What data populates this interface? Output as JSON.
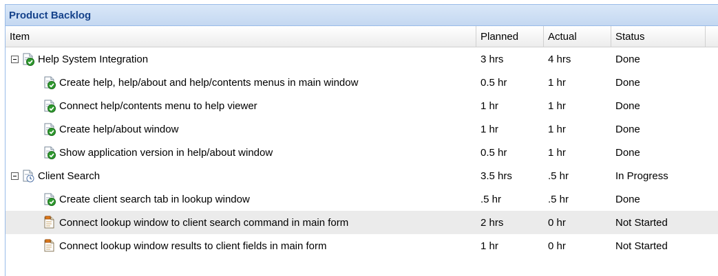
{
  "panel": {
    "title": "Product Backlog"
  },
  "columns": {
    "item": "Item",
    "planned": "Planned",
    "actual": "Actual",
    "status": "Status"
  },
  "rows": [
    {
      "item": "Help System Integration",
      "planned": "3 hrs",
      "actual": "4 hrs",
      "status": "Done",
      "level": 0,
      "icon": "task-done-icon",
      "expanded": true
    },
    {
      "item": "Create help, help/about and help/contents menus in main window",
      "planned": "0.5 hr",
      "actual": "1 hr",
      "status": "Done",
      "level": 1,
      "icon": "task-done-icon"
    },
    {
      "item": "Connect help/contents menu to help viewer",
      "planned": "1 hr",
      "actual": "1 hr",
      "status": "Done",
      "level": 1,
      "icon": "task-done-icon"
    },
    {
      "item": "Create help/about window",
      "planned": "1 hr",
      "actual": "1 hr",
      "status": "Done",
      "level": 1,
      "icon": "task-done-icon"
    },
    {
      "item": "Show application version in help/about window",
      "planned": "0.5 hr",
      "actual": "1 hr",
      "status": "Done",
      "level": 1,
      "icon": "task-done-icon"
    },
    {
      "item": "Client Search",
      "planned": "3.5 hrs",
      "actual": ".5 hr",
      "status": "In Progress",
      "level": 0,
      "icon": "task-in-progress-icon",
      "expanded": true
    },
    {
      "item": "Create client search tab in lookup window",
      "planned": ".5 hr",
      "actual": ".5 hr",
      "status": "Done",
      "level": 1,
      "icon": "task-done-icon"
    },
    {
      "item": "Connect lookup window to client search command in main form",
      "planned": "2 hrs",
      "actual": "0 hr",
      "status": "Not Started",
      "level": 1,
      "icon": "task-not-started-icon",
      "selected": true
    },
    {
      "item": "Connect lookup window results to client fields in main form",
      "planned": "1 hr",
      "actual": "0 hr",
      "status": "Not Started",
      "level": 1,
      "icon": "task-not-started-icon"
    }
  ]
}
